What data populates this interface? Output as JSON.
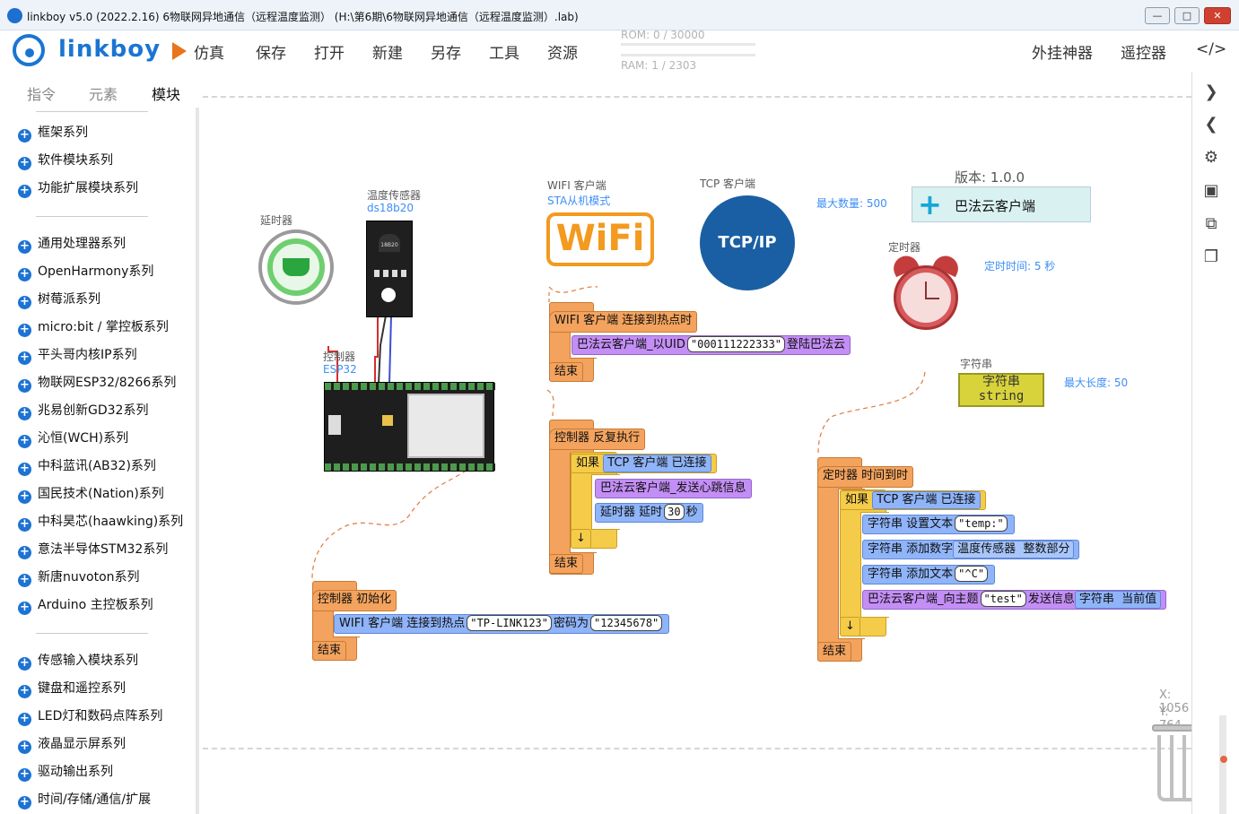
{
  "window": {
    "title": "linkboy v5.0 (2022.2.16) 6物联网异地通信（远程温度监测） (H:\\第6期\\6物联网异地通信（远程温度监测）.lab)",
    "min": "—",
    "max": "□",
    "close": "✕"
  },
  "menubar": {
    "logo": "linkboy",
    "items": [
      "仿真",
      "保存",
      "打开",
      "新建",
      "另存",
      "工具",
      "资源"
    ],
    "rom": "ROM: 0 / 30000",
    "ram": "RAM: 1 / 2303",
    "right_items": [
      "外挂神器",
      "遥控器",
      "</>"
    ]
  },
  "tabs": [
    "指令",
    "元素",
    "模块"
  ],
  "active_tab": "模块",
  "sidebar": {
    "group1": [
      "框架系列",
      "软件模块系列",
      "功能扩展模块系列"
    ],
    "group2": [
      "通用处理器系列",
      "OpenHarmony系列",
      "树莓派系列",
      "micro:bit / 掌控板系列",
      "平头哥内核IP系列",
      "物联网ESP32/8266系列",
      "兆易创新GD32系列",
      "沁恒(WCH)系列",
      "中科蓝讯(AB32)系列",
      "国民技术(Nation)系列",
      "中科昊芯(haawking)系列",
      "意法半导体STM32系列",
      "新唐nuvoton系列",
      "Arduino 主控板系列"
    ],
    "group3": [
      "传感输入模块系列",
      "键盘和遥控系列",
      "LED灯和数码点阵系列",
      "液晶显示屏系列",
      "驱动输出系列",
      "时间/存储/通信/扩展"
    ]
  },
  "components": {
    "delay": {
      "label": "延时器"
    },
    "temp": {
      "label": "温度传感器",
      "sub": "ds18b20",
      "chip_text": "18B20"
    },
    "controller": {
      "label": "控制器",
      "sub": "ESP32"
    },
    "wifi": {
      "label": "WIFI 客户端",
      "sub": "STA从机模式",
      "logo": "WiFi"
    },
    "tcp": {
      "label": "TCP 客户端",
      "logo": "TCP/IP",
      "max": "最大数量: 500"
    },
    "bafa": {
      "version": "版本: 1.0.0",
      "name": "巴法云客户端"
    },
    "timer": {
      "label": "定时器",
      "interval": "定时时间: 5 秒"
    },
    "string": {
      "label": "字符串",
      "line1": "字符串",
      "line2": "string",
      "max": "最大长度: 50"
    }
  },
  "blocks": {
    "wifi_event": {
      "obj": "WIFI 客户端",
      "evt": "连接到热点时",
      "a": "巴法云客户端_以UID",
      "uid": "\"000111222333\"",
      "b": "登陆巴法云",
      "end": "结束"
    },
    "loop": {
      "obj": "控制器",
      "evt": "反复执行",
      "if": "如果",
      "tcp": "TCP 客户端",
      "connected": "已连接",
      "heart": "巴法云客户端_发送心跳信息",
      "delay_obj": "延时器",
      "delay_act": "延时",
      "delay_val": "30",
      "delay_unit": "秒",
      "down": "↓",
      "end": "结束"
    },
    "init": {
      "obj": "控制器",
      "evt": "初始化",
      "w": "WIFI 客户端",
      "act": "连接到热点",
      "ssid": "\"TP-LINK123\"",
      "pw_label": "密码为",
      "pw": "\"12345678\"",
      "end": "结束"
    },
    "timer_event": {
      "obj": "定时器",
      "evt": "时间到时",
      "if": "如果",
      "tcp": "TCP 客户端",
      "connected": "已连接",
      "s1_obj": "字符串",
      "s1_act": "设置文本",
      "s1_val": "\"temp:\"",
      "s2_obj": "字符串",
      "s2_act": "添加数字",
      "s2_sensor": "温度传感器",
      "s2_part": "整数部分",
      "s3_obj": "字符串",
      "s3_act": "添加文本",
      "s3_val": "\"^C\"",
      "s4_a": "巴法云客户端_向主题",
      "s4_topic": "\"test\"",
      "s4_b": "发送信息",
      "s4_obj": "字符串",
      "s4_cur": "当前值",
      "down": "↓",
      "end": "结束"
    }
  },
  "coords": {
    "x": "X: 1056",
    "y": "Y: 764"
  },
  "colors": {
    "brand": "#1a75d2",
    "event": "#f3a35d",
    "object": "#8fb4f9",
    "bafa": "#c38ef5",
    "control": "#f5cb4a"
  }
}
